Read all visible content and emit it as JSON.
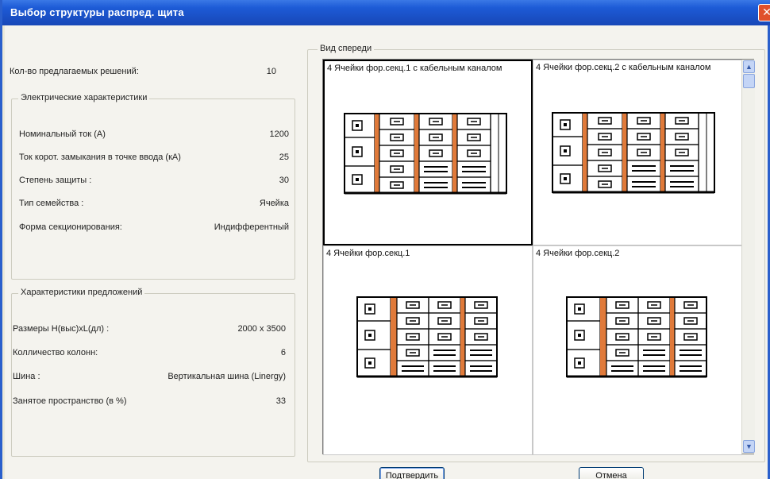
{
  "window": {
    "title": "Выбор структуры распред. щита",
    "close_glyph": "✕"
  },
  "solutions": {
    "label": "Кол-во предлагаемых решений:",
    "value": "10"
  },
  "electrical": {
    "legend": "Электрические характеристики",
    "rows": [
      {
        "label": "Номинальный ток (А)",
        "value": "1200"
      },
      {
        "label": "Ток корот. замыкания в точке ввода (кА)",
        "value": "25"
      },
      {
        "label": "Степень защиты :",
        "value": "30"
      },
      {
        "label": "Тип семейства :",
        "value": "Ячейка"
      },
      {
        "label": "Форма секционирования:",
        "value": "Индифферентный"
      }
    ]
  },
  "offer": {
    "legend": "Характеристики предложений",
    "rows": [
      {
        "label": "Размеры Н(выс)хL(дл) :",
        "value": "2000 x 3500"
      },
      {
        "label": "Колличество колонн:",
        "value": "6"
      },
      {
        "label": "Шина :",
        "value": "Вертикальная шина (Linergy)"
      },
      {
        "label": "Занятое пространство (в %)",
        "value": "33"
      }
    ]
  },
  "preview": {
    "legend": "Вид спереди",
    "options": [
      {
        "label": "4 Ячейки фор.секц.1 с кабельным каналом",
        "selected": true,
        "cable_channel": true
      },
      {
        "label": "4 Ячейки фор.секц.2 с кабельным каналом",
        "selected": false,
        "cable_channel": true
      },
      {
        "label": "4 Ячейки фор.секц.1",
        "selected": false,
        "cable_channel": false
      },
      {
        "label": "4 Ячейки фор.секц.2",
        "selected": false,
        "cable_channel": false
      }
    ]
  },
  "scrollbar": {
    "up_glyph": "▲",
    "down_glyph": "▼"
  },
  "buttons": {
    "confirm": "Подтвердить",
    "cancel": "Отмена"
  },
  "colors": {
    "title_bar": "#1d5bd6",
    "accent_orange": "#e07a3a",
    "panel_bg": "#f4f3ee"
  }
}
